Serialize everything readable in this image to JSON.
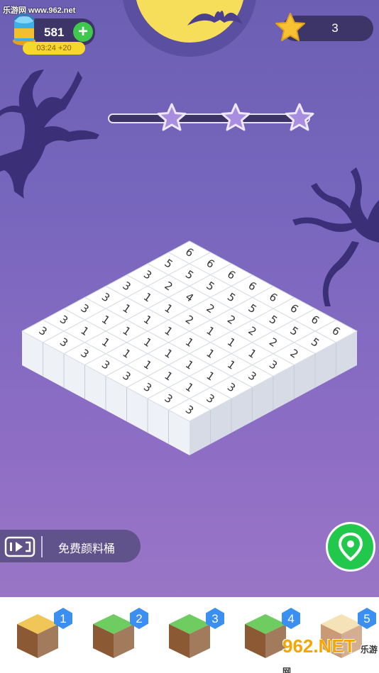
{
  "watermark": "乐游网 www.962.net",
  "hud": {
    "coins": "581",
    "plus_label": "+",
    "timer": "03:24 +20",
    "stars": "3"
  },
  "progress": {
    "milestone_stars": 3
  },
  "board": {
    "rows": [
      [
        "6",
        "6",
        "6",
        "6",
        "6",
        "6",
        "6",
        "6"
      ],
      [
        "5",
        "5",
        "5",
        "5",
        "5",
        "5",
        "5",
        "5"
      ],
      [
        "3",
        "2",
        "4",
        "2",
        "2",
        "2",
        "2",
        "2"
      ],
      [
        "3",
        "1",
        "1",
        "2",
        "1",
        "1",
        "1",
        "3"
      ],
      [
        "3",
        "1",
        "1",
        "1",
        "1",
        "1",
        "1",
        "3"
      ],
      [
        "3",
        "1",
        "1",
        "1",
        "1",
        "1",
        "1",
        "3"
      ],
      [
        "3",
        "1",
        "1",
        "1",
        "1",
        "1",
        "1",
        "3"
      ],
      [
        "3",
        "3",
        "3",
        "3",
        "3",
        "3",
        "3",
        "3"
      ]
    ]
  },
  "bottom": {
    "video_label": "免费颜料桶",
    "tray": [
      {
        "badge": "1",
        "top": "#f0c659",
        "side": "#8b5a34"
      },
      {
        "badge": "2",
        "top": "#6fcc61",
        "side": "#8b5a34"
      },
      {
        "badge": "3",
        "top": "#6fcc61",
        "side": "#8b5a34"
      },
      {
        "badge": "4",
        "top": "#6fcc61",
        "side": "#8b5a34"
      },
      {
        "badge": "5",
        "top": "#f6e2b7",
        "side": "#c99a74"
      }
    ],
    "watermark2_big": "962.NET",
    "watermark2_small": "乐游网"
  },
  "colors": {
    "badge": "#3a8ff0",
    "tile_top": "#ffffff",
    "tile_left": "#eef1f6",
    "tile_right": "#d6dbe5"
  }
}
